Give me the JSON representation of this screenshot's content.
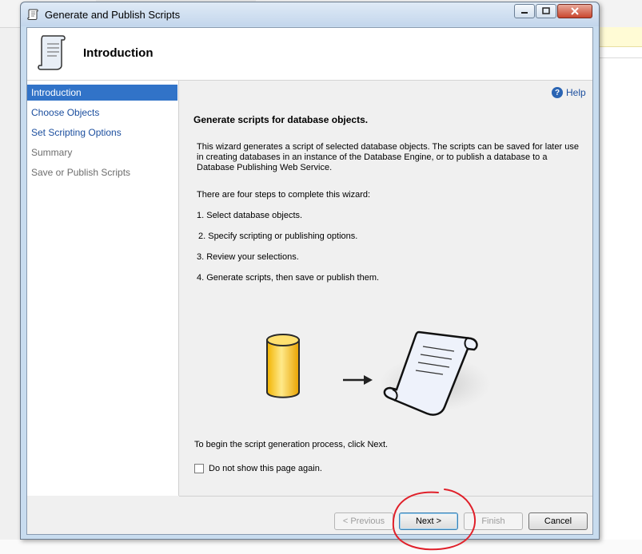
{
  "window": {
    "title": "Generate and Publish Scripts"
  },
  "header": {
    "title": "Introduction"
  },
  "sidebar": {
    "items": [
      {
        "label": "Introduction",
        "state": "active"
      },
      {
        "label": "Choose Objects",
        "state": "link"
      },
      {
        "label": "Set Scripting Options",
        "state": "link"
      },
      {
        "label": "Summary",
        "state": "disabled"
      },
      {
        "label": "Save or Publish Scripts",
        "state": "disabled"
      }
    ]
  },
  "content": {
    "help_label": "Help",
    "heading": "Generate scripts for database objects.",
    "description": "This wizard generates a script of selected database objects. The scripts can be saved for later use in creating databases in an instance of the Database Engine, or to publish a database to a Database Publishing Web Service.",
    "steps_intro": "There are four steps to complete this wizard:",
    "steps": [
      "1. Select database objects.",
      "2. Specify scripting or publishing options.",
      "3. Review your selections.",
      "4. Generate scripts, then save or publish them."
    ],
    "begin_text": "To begin the script generation process, click Next.",
    "checkbox_label": "Do not show this page again."
  },
  "buttons": {
    "previous": "< Previous",
    "next": "Next >",
    "finish": "Finish",
    "cancel": "Cancel"
  },
  "colors": {
    "accent": "#3173c8",
    "annotation": "#e0202a"
  }
}
